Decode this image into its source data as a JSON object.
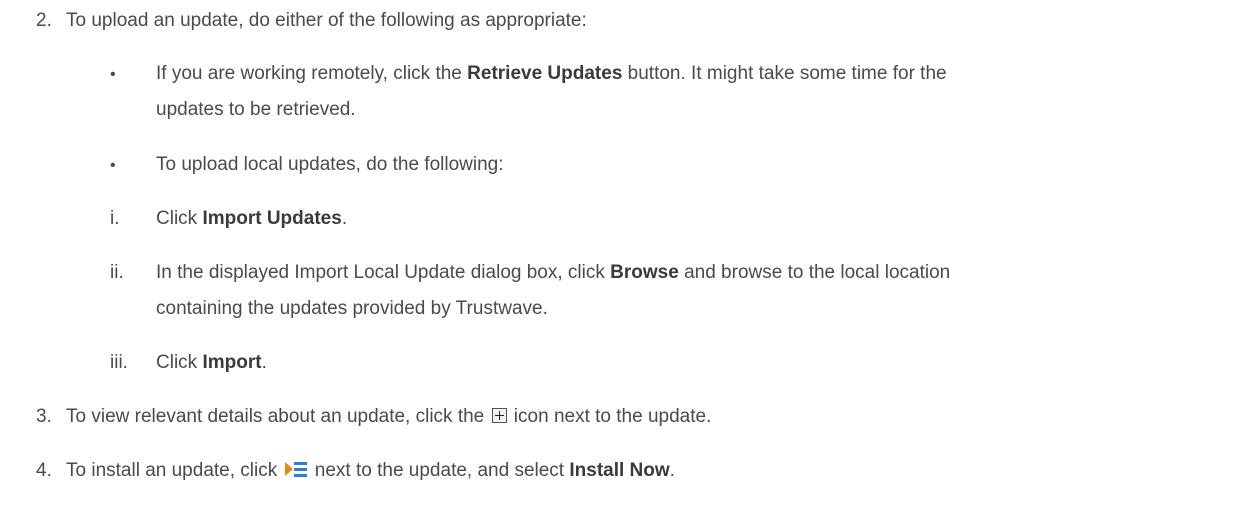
{
  "steps": {
    "s2": {
      "num": "2.",
      "text": "To upload an update, do either of the following as appropriate:"
    },
    "b1": {
      "bullet": "•",
      "pre": "If you are working remotely, click the ",
      "bold": "Retrieve Updates",
      "post": " button. It might take some time for the",
      "line2": "updates to be retrieved."
    },
    "b2": {
      "bullet": "•",
      "text": "To upload local updates, do the following:"
    },
    "i": {
      "num": "i.",
      "pre": "Click ",
      "bold": "Import Updates",
      "post": "."
    },
    "ii": {
      "num": "ii.",
      "pre": "In the displayed Import Local Update dialog box, click ",
      "bold": "Browse",
      "post": " and browse to the local location",
      "line2": "containing the updates provided by Trustwave."
    },
    "iii": {
      "num": "iii.",
      "pre": "Click ",
      "bold": "Import",
      "post": "."
    },
    "s3": {
      "num": "3.",
      "pre": "To view relevant details about an update, click the ",
      "icon": "expand-plus-icon",
      "post": " icon next to the update."
    },
    "s4": {
      "num": "4.",
      "pre": "To install an update, click ",
      "icon": "actions-menu-icon",
      "mid": " next to the update, and select ",
      "bold": "Install Now",
      "post": "."
    }
  }
}
